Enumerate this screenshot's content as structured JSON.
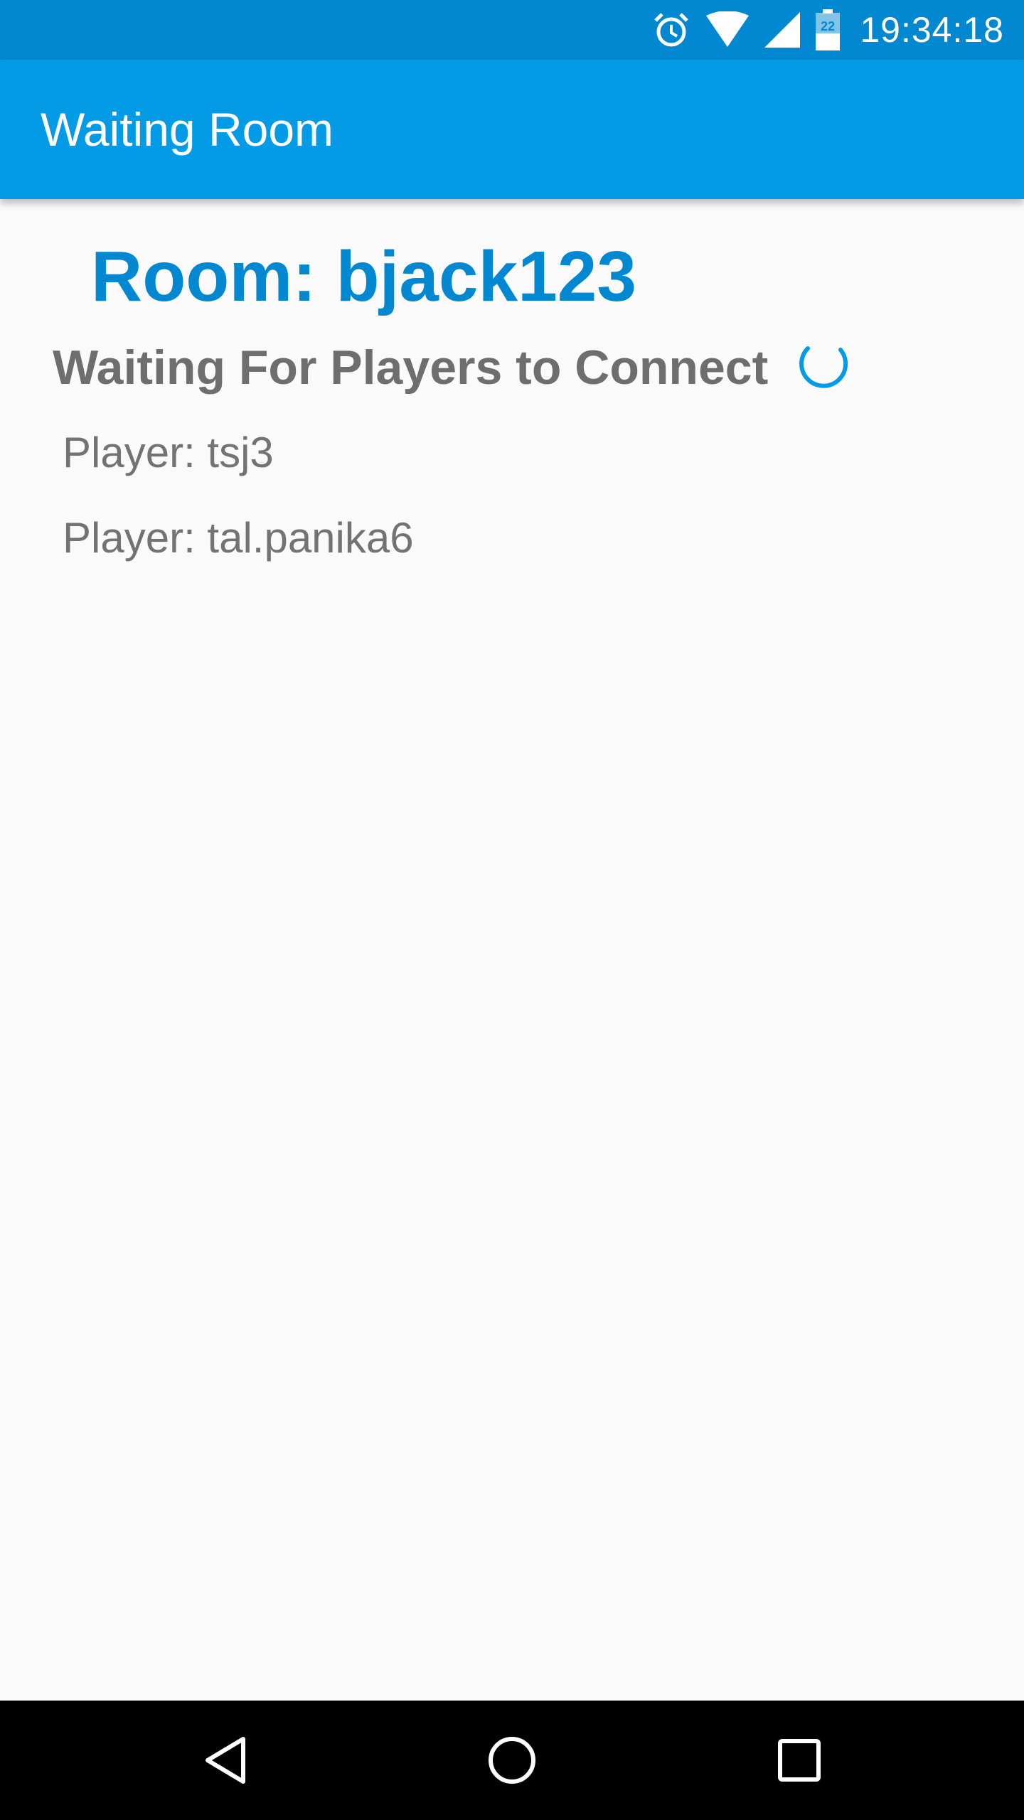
{
  "status_bar": {
    "time": "19:34:18",
    "battery_level": "22",
    "icons": [
      "alarm-icon",
      "wifi-icon",
      "signal-icon",
      "battery-icon"
    ]
  },
  "app_bar": {
    "title": "Waiting Room"
  },
  "room": {
    "title": "Room: bjack123",
    "waiting_message": "Waiting For Players to Connect",
    "players": [
      {
        "label": "Player: tsj3"
      },
      {
        "label": "Player: tal.panika6"
      }
    ]
  },
  "nav_bar": {
    "icons": [
      "back-icon",
      "home-icon",
      "recents-icon"
    ]
  },
  "colors": {
    "status_bar": "#0288d1",
    "app_bar": "#039be5",
    "accent": "#0288d1",
    "background": "#fafafa",
    "secondary_text": "#6e6e6e"
  }
}
